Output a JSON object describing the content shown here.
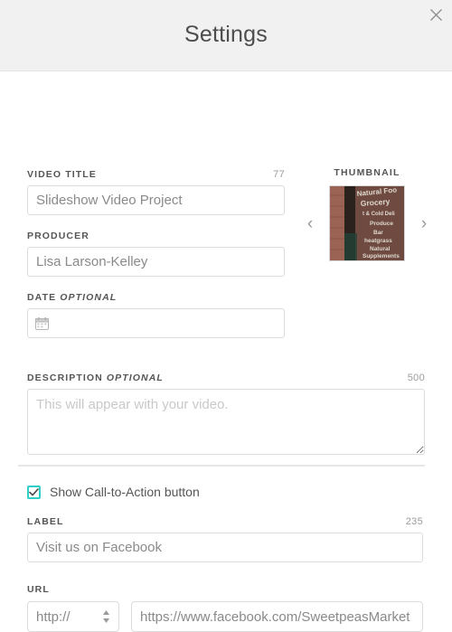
{
  "header": {
    "title": "Settings",
    "close_icon": "close-icon"
  },
  "form": {
    "video_title": {
      "label": "Video Title",
      "counter": "77",
      "value": "Slideshow Video Project"
    },
    "producer": {
      "label": "Producer",
      "value": "Lisa Larson-Kelley"
    },
    "date": {
      "label": "Date",
      "optional": "Optional",
      "value": "",
      "placeholder": "",
      "icon": "calendar-icon"
    },
    "description": {
      "label": "Description",
      "optional": "Optional",
      "counter": "500",
      "value": "",
      "placeholder": "This will appear with your video."
    }
  },
  "thumbnail": {
    "title": "Thumbnail",
    "prev_icon": "chevron-left-icon",
    "next_icon": "chevron-right-icon",
    "alt": "storefront-sign-photo",
    "sign_lines": [
      "Natural Foods",
      "Grocery",
      "Hot & Cold Deli",
      "Produce",
      "Bar",
      "Wheatgrass",
      "Natural",
      "Supplements"
    ]
  },
  "cta": {
    "checkbox_label": "Show Call-to-Action button",
    "checked": true,
    "check_icon": "checkmark-icon",
    "label_field": {
      "label": "Label",
      "counter": "235",
      "value": "Visit us on Facebook"
    },
    "url_field": {
      "label": "URL",
      "scheme": "http://",
      "scheme_icon": "updown-stepper-icon",
      "value": "https://www.facebook.com/SweetpeasMarket"
    }
  },
  "colors": {
    "header_bg": "#f1f1f1",
    "accent": "#2ed0c8",
    "border": "#dcdcdc",
    "text": "#555555",
    "muted": "#9b9b9b"
  }
}
